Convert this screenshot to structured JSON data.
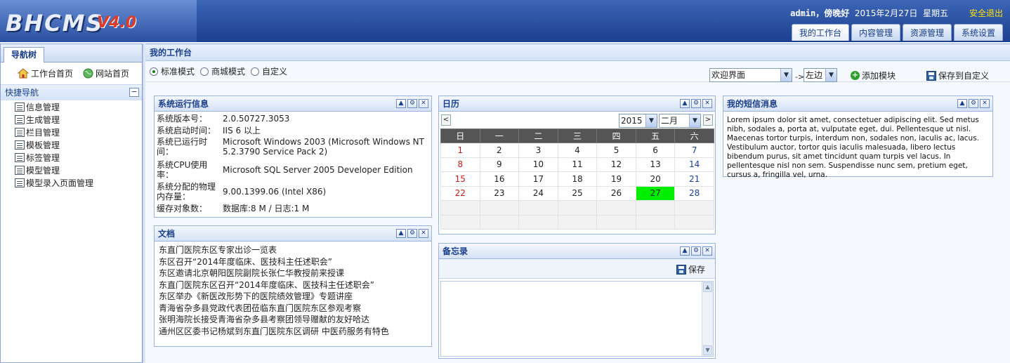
{
  "header": {
    "logo": "BHCMS",
    "logo_version": "V4.0",
    "user": "admin",
    "greeting": "，傍晚好",
    "date": "2015年2月27日",
    "weekday": "星期五",
    "logout": "安全退出",
    "tabs": [
      {
        "label": "我的工作台",
        "active": true
      },
      {
        "label": "内容管理",
        "active": false
      },
      {
        "label": "资源管理",
        "active": false
      },
      {
        "label": "系统设置",
        "active": false
      }
    ]
  },
  "leftnav": {
    "tab": "导航树",
    "home_link": "工作台首页",
    "site_link": "网站首页",
    "quick_nav": "快捷导航",
    "collapse_icon": "−",
    "items": [
      "信息管理",
      "生成管理",
      "栏目管理",
      "模板管理",
      "标签管理",
      "模型管理",
      "模型录入页面管理"
    ]
  },
  "main": {
    "title": "我的工作台",
    "modes": [
      {
        "label": "标准模式",
        "checked": true
      },
      {
        "label": "商城模式",
        "checked": false
      },
      {
        "label": "自定义",
        "checked": false
      }
    ],
    "module_select": "欢迎界面",
    "position_arrow": "->",
    "position_select": "左边",
    "add_module": "添加模块",
    "save_custom": "保存到自定义"
  },
  "sysinfo": {
    "title": "系统运行信息",
    "rows": [
      {
        "label": "系统版本号：",
        "value": "2.0.50727.3053"
      },
      {
        "label": "系统启动时间：",
        "value": "IIS 6 以上"
      },
      {
        "label": "系统已运行时间：",
        "value": "Microsoft Windows 2003 (Microsoft Windows NT 5.2.3790 Service Pack 2)"
      },
      {
        "label": "系统CPU使用率：",
        "value": "Microsoft SQL Server 2005 Developer Edition"
      },
      {
        "label": "系统分配的物理内存量：",
        "value": "9.00.1399.06 (Intel X86)"
      },
      {
        "label": "缓存对象数：",
        "value": "数据库:8 M / 日志:1 M"
      }
    ]
  },
  "docs": {
    "title": "文档",
    "items": [
      "东直门医院东区专家出诊一览表",
      "东区召开“2014年度临床、医技科主任述职会”",
      "东区邀请北京朝阳医院副院长张仁华教授前来授课",
      "东直门医院东区召开“2014年度临床、医技科主任述职会”",
      "东区举办《新医改形势下的医院绩效管理》专题讲座",
      "青海省杂多县党政代表团莅临东直门医院东区参观考察",
      "张明海院长接受青海省杂多县考察团领导赠献的友好哈达",
      "通州区区委书记杨斌到东直门医院东区调研 中医药服务有特色"
    ]
  },
  "calendar": {
    "title": "日历",
    "prev": "<",
    "next": ">",
    "year": "2015",
    "month": "二月",
    "weekdays": [
      "日",
      "一",
      "二",
      "三",
      "四",
      "五",
      "六"
    ],
    "weeks": [
      [
        "1",
        "2",
        "3",
        "4",
        "5",
        "6",
        "7"
      ],
      [
        "8",
        "9",
        "10",
        "11",
        "12",
        "13",
        "14"
      ],
      [
        "15",
        "16",
        "17",
        "18",
        "19",
        "20",
        "21"
      ],
      [
        "22",
        "23",
        "24",
        "25",
        "26",
        "27",
        "28"
      ],
      [
        "",
        "",
        "",
        "",
        "",
        "",
        ""
      ],
      [
        "",
        "",
        "",
        "",
        "",
        "",
        ""
      ]
    ],
    "today": "27",
    "today_color": "#00ee00"
  },
  "memo": {
    "title": "备忘录",
    "save": "保存",
    "content": ""
  },
  "sms": {
    "title": "我的短信消息",
    "text": "Lorem ipsum dolor sit amet, consectetuer adipiscing elit. Sed metus nibh, sodales a, porta at, vulputate eget, dui. Pellentesque ut nisl. Maecenas tortor turpis, interdum non, sodales non, iaculis ac, lacus. Vestibulum auctor, tortor quis iaculis malesuada, libero lectus bibendum purus, sit amet tincidunt quam turpis vel lacus. In pellentesque nisl non sem. Suspendisse nunc sem, pretium eget, cursus a, fringilla vel, urna."
  },
  "panel_controls": {
    "collapse": "▲",
    "settings": "⚙",
    "close": "✕"
  },
  "icons": {
    "home": "home-icon",
    "site": "globe-icon",
    "doc": "document-icon",
    "add": "add-icon",
    "save": "save-icon"
  }
}
